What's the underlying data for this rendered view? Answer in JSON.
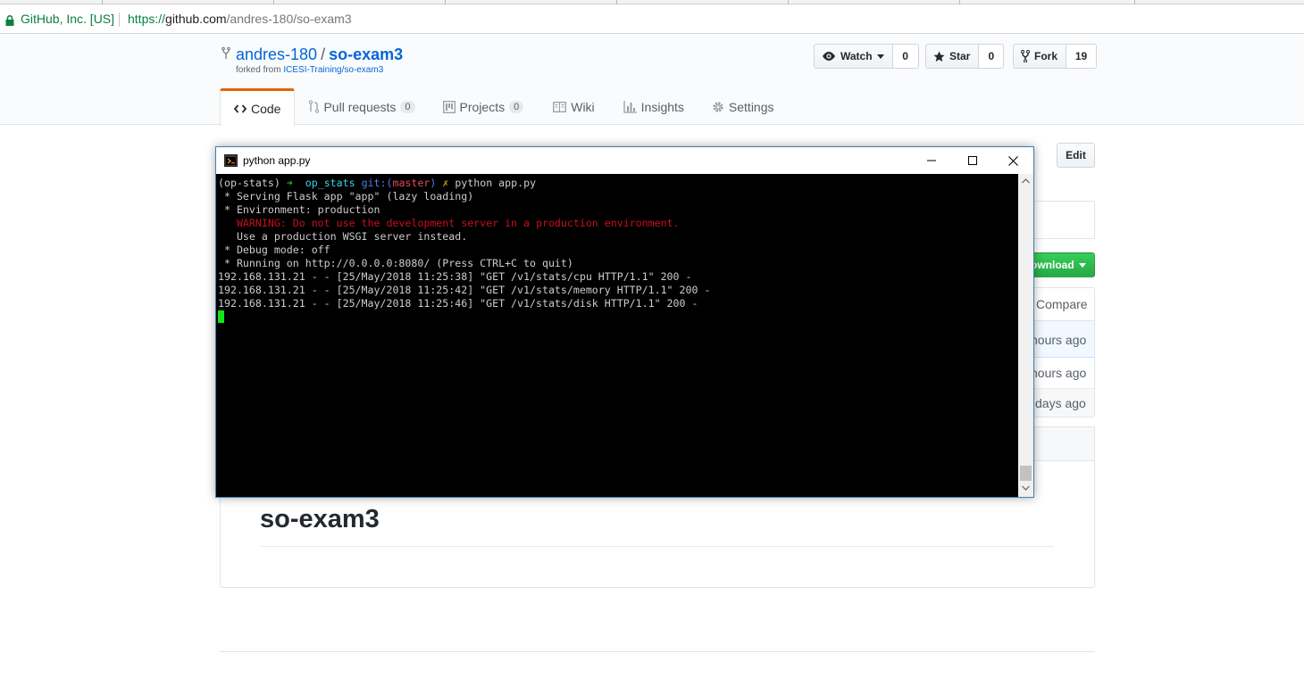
{
  "browser": {
    "site_identity": "GitHub, Inc. [US]",
    "url_protocol": "https://",
    "url_host": "github.com",
    "url_path": "/andres-180/so-exam3"
  },
  "repo": {
    "owner": "andres-180",
    "separator": "/",
    "name": "so-exam3",
    "forked_from_prefix": "forked from ",
    "forked_from": "ICESI-Training/so-exam3"
  },
  "actions": {
    "watch_label": "Watch",
    "watch_count": "0",
    "star_label": "Star",
    "star_count": "0",
    "fork_label": "Fork",
    "fork_count": "19"
  },
  "tabs": [
    {
      "label": "Code",
      "icon": "code-icon"
    },
    {
      "label": "Pull requests",
      "counter": "0",
      "icon": "pull-request-icon"
    },
    {
      "label": "Projects",
      "counter": "0",
      "icon": "project-icon"
    },
    {
      "label": "Wiki",
      "icon": "book-icon"
    },
    {
      "label": "Insights",
      "icon": "graph-icon"
    },
    {
      "label": "Settings",
      "icon": "gear-icon"
    }
  ],
  "page": {
    "edit_label": "Edit",
    "download_label": "ownload",
    "compare_label": "Compare",
    "file_times": [
      "hours ago",
      "hours ago",
      "days ago"
    ],
    "readme_title": "so-exam3"
  },
  "console": {
    "title": "python app.py",
    "prompt_env": "(op-stats)",
    "prompt_arrow": "➜",
    "prompt_dir": "op_stats",
    "prompt_git": "git:(",
    "prompt_branch": "master",
    "prompt_git_close": ")",
    "prompt_dirty": "✗",
    "command": "python app.py",
    "lines": {
      "serving": " * Serving Flask app \"app\" (lazy loading)",
      "environment": " * Environment: production",
      "warning": "   WARNING: Do not use the development server in a production environment.",
      "wsgi": "   Use a production WSGI server instead.",
      "debug": " * Debug mode: off",
      "running": " * Running on http://0.0.0.0:8080/ (Press CTRL+C to quit)",
      "log1": "192.168.131.21 - - [25/May/2018 11:25:38] \"GET /v1/stats/cpu HTTP/1.1\" 200 -",
      "log2": "192.168.131.21 - - [25/May/2018 11:25:42] \"GET /v1/stats/memory HTTP/1.1\" 200 -",
      "log3": "192.168.131.21 - - [25/May/2018 11:25:46] \"GET /v1/stats/disk HTTP/1.1\" 200 -"
    }
  }
}
